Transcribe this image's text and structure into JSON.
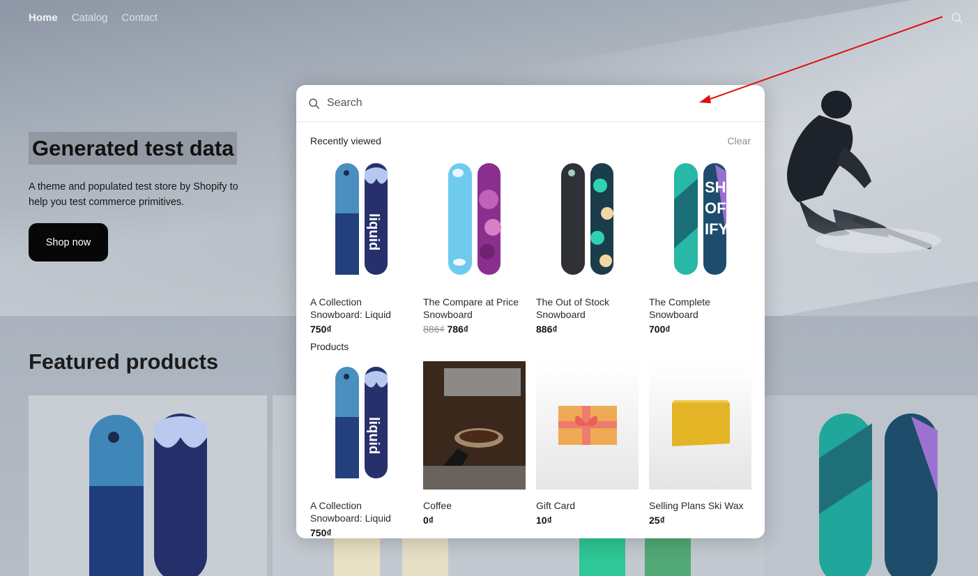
{
  "nav": {
    "items": [
      {
        "label": "Home",
        "active": true
      },
      {
        "label": "Catalog",
        "active": false
      },
      {
        "label": "Contact",
        "active": false
      }
    ]
  },
  "hero": {
    "title": "Generated test data",
    "description": "A theme and populated test store by Shopify to help you test commerce primitives.",
    "button": "Shop now"
  },
  "featured": {
    "title": "Featured products"
  },
  "search": {
    "placeholder": "Search",
    "recently_viewed_label": "Recently viewed",
    "clear_label": "Clear",
    "products_label": "Products",
    "recent": [
      {
        "name": "A Collection Snowboard: Liquid",
        "price": "750₫",
        "compare": ""
      },
      {
        "name": "The Compare at Price Snowboard",
        "price": "786₫",
        "compare": "886₫"
      },
      {
        "name": "The Out of Stock Snowboard",
        "price": "886₫",
        "compare": ""
      },
      {
        "name": "The Complete Snowboard",
        "price": "700₫",
        "compare": ""
      }
    ],
    "products": [
      {
        "name": "A Collection Snowboard: Liquid",
        "price": "750₫"
      },
      {
        "name": "Coffee",
        "price": "0₫"
      },
      {
        "name": "Gift Card",
        "price": "10₫"
      },
      {
        "name": "Selling Plans Ski Wax",
        "price": "25₫"
      }
    ]
  },
  "colors": {
    "annotation_arrow": "#e01010",
    "button_bg": "#070707"
  }
}
